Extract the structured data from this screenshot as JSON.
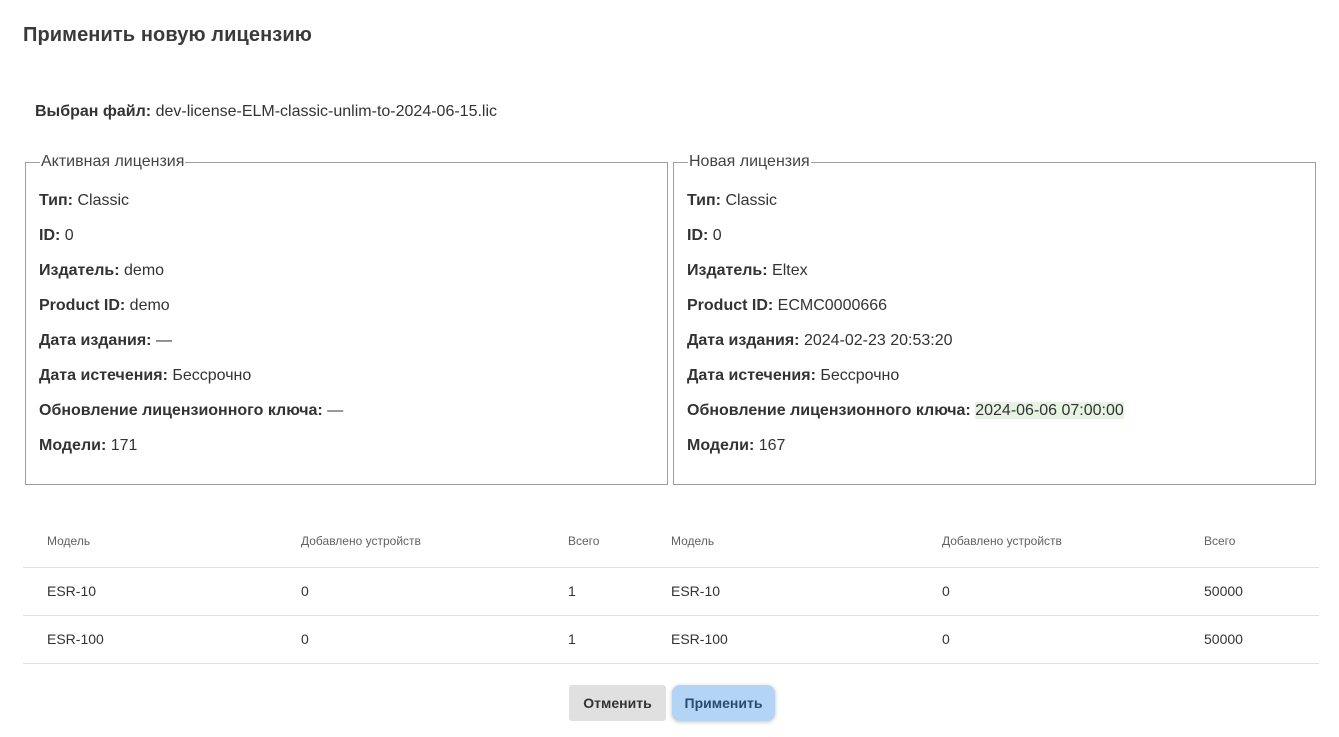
{
  "dialog": {
    "title": "Применить новую лицензию",
    "selected_file_label": "Выбран файл:",
    "selected_file_name": "dev-license-ELM-classic-unlim-to-2024-06-15.lic"
  },
  "active_license": {
    "legend": "Активная лицензия",
    "fields": [
      {
        "label": "Тип:",
        "value": "Classic"
      },
      {
        "label": "ID:",
        "value": "0"
      },
      {
        "label": "Издатель:",
        "value": "demo"
      },
      {
        "label": "Product ID:",
        "value": "demo"
      },
      {
        "label": "Дата издания:",
        "value": "—"
      },
      {
        "label": "Дата истечения:",
        "value": "Бессрочно"
      },
      {
        "label": "Обновление лицензионного ключа:",
        "value": "—"
      },
      {
        "label": "Модели:",
        "value": "171"
      }
    ]
  },
  "new_license": {
    "legend": "Новая лицензия",
    "fields": [
      {
        "label": "Тип:",
        "value": "Classic"
      },
      {
        "label": "ID:",
        "value": "0"
      },
      {
        "label": "Издатель:",
        "value": "Eltex"
      },
      {
        "label": "Product ID:",
        "value": "ECMC0000666"
      },
      {
        "label": "Дата издания:",
        "value": "2024-02-23 20:53:20"
      },
      {
        "label": "Дата истечения:",
        "value": "Бессрочно"
      },
      {
        "label": "Обновление лицензионного ключа:",
        "value": "2024-06-06 07:00:00"
      },
      {
        "label": "Модели:",
        "value": "167"
      }
    ]
  },
  "models_table": {
    "headers": [
      "Модель",
      "Добавлено устройств",
      "Всего",
      "Модель",
      "Добавлено устройств",
      "Всего"
    ],
    "rows": [
      [
        "ESR-10",
        "0",
        "1",
        "ESR-10",
        "0",
        "50000"
      ],
      [
        "ESR-100",
        "0",
        "1",
        "ESR-100",
        "0",
        "50000"
      ]
    ]
  },
  "buttons": {
    "cancel": "Отменить",
    "apply": "Применить"
  },
  "colors": {
    "highlight": "#e6f2e2",
    "apply_button": "#b3d4f5",
    "cancel_button": "#e0e0e0"
  }
}
